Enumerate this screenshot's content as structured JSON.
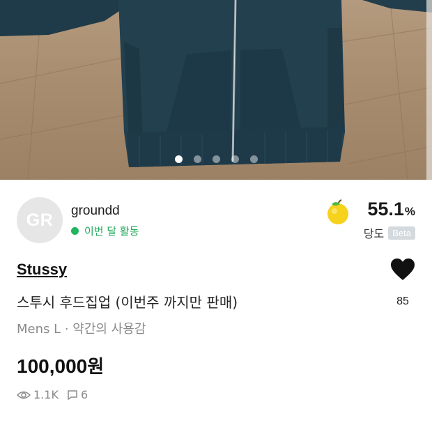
{
  "gallery": {
    "image_count": 5,
    "active_index": 0
  },
  "seller": {
    "avatar_initials": "GR",
    "name": "groundd",
    "activity": "이번 달 활동"
  },
  "sweetness": {
    "value": "55.1",
    "unit": "%",
    "label": "당도",
    "badge": "Beta",
    "icon": "apple-icon"
  },
  "product": {
    "brand": "Stussy",
    "title": "스투시 후드집업 (이번주 까지만 판매)",
    "meta": "Mens L · 약간의 사용감",
    "price_number": "100,000",
    "price_unit": "원"
  },
  "stats": {
    "views": "1.1K",
    "chats": "6"
  },
  "likes": {
    "count": "85"
  },
  "colors": {
    "activity_green": "#22b45e",
    "beta_bg": "#d4d9de",
    "text_dark": "#111111",
    "text_muted": "#8a8a8a"
  }
}
